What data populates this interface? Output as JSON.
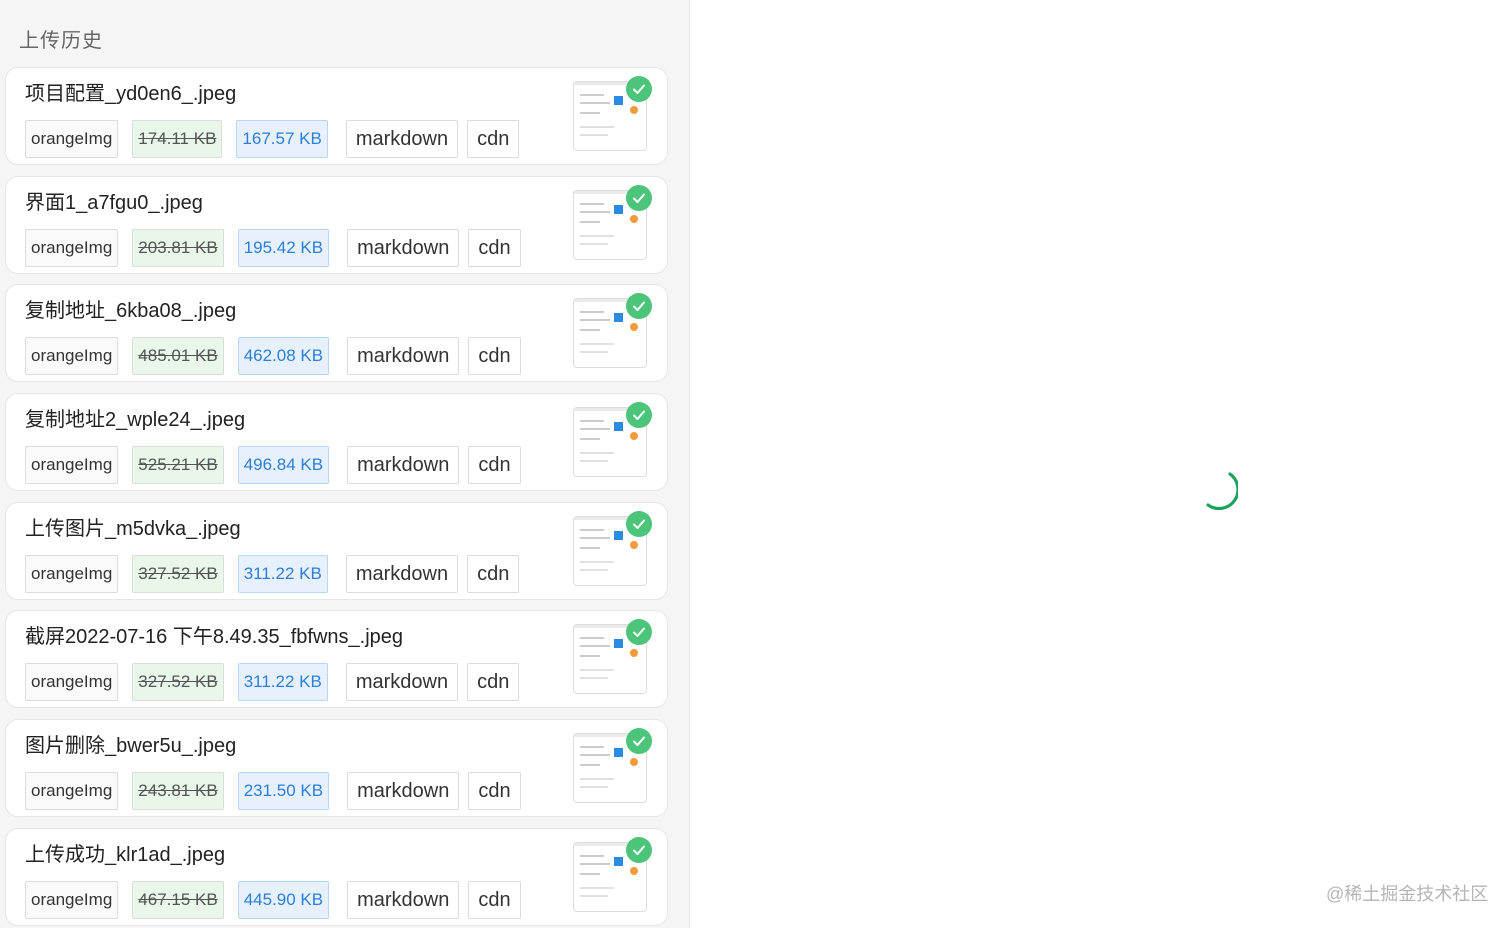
{
  "sidebar": {
    "title": "上传历史"
  },
  "labels": {
    "source": "orangeImg",
    "markdown": "markdown",
    "cdn": "cdn"
  },
  "items": [
    {
      "name": "项目配置_yd0en6_.jpeg",
      "original_size": "174.11 KB",
      "compressed_size": "167.57 KB",
      "status": "success"
    },
    {
      "name": "界面1_a7fgu0_.jpeg",
      "original_size": "203.81 KB",
      "compressed_size": "195.42 KB",
      "status": "success"
    },
    {
      "name": "复制地址_6kba08_.jpeg",
      "original_size": "485.01 KB",
      "compressed_size": "462.08 KB",
      "status": "success"
    },
    {
      "name": "复制地址2_wple24_.jpeg",
      "original_size": "525.21 KB",
      "compressed_size": "496.84 KB",
      "status": "success"
    },
    {
      "name": "上传图片_m5dvka_.jpeg",
      "original_size": "327.52 KB",
      "compressed_size": "311.22 KB",
      "status": "success"
    },
    {
      "name": "截屏2022-07-16 下午8.49.35_fbfwns_.jpeg",
      "original_size": "327.52 KB",
      "compressed_size": "311.22 KB",
      "status": "success"
    },
    {
      "name": "图片删除_bwer5u_.jpeg",
      "original_size": "243.81 KB",
      "compressed_size": "231.50 KB",
      "status": "success"
    },
    {
      "name": "上传成功_klr1ad_.jpeg",
      "original_size": "467.15 KB",
      "compressed_size": "445.90 KB",
      "status": "success"
    }
  ],
  "icons": {
    "status": "check-circle-icon",
    "loading": "spinner-icon"
  },
  "colors": {
    "success": "#4cc47a",
    "compressed_text": "#2b7fd9",
    "spinner": "#1aa260"
  },
  "watermark": "@稀土掘金技术社区"
}
